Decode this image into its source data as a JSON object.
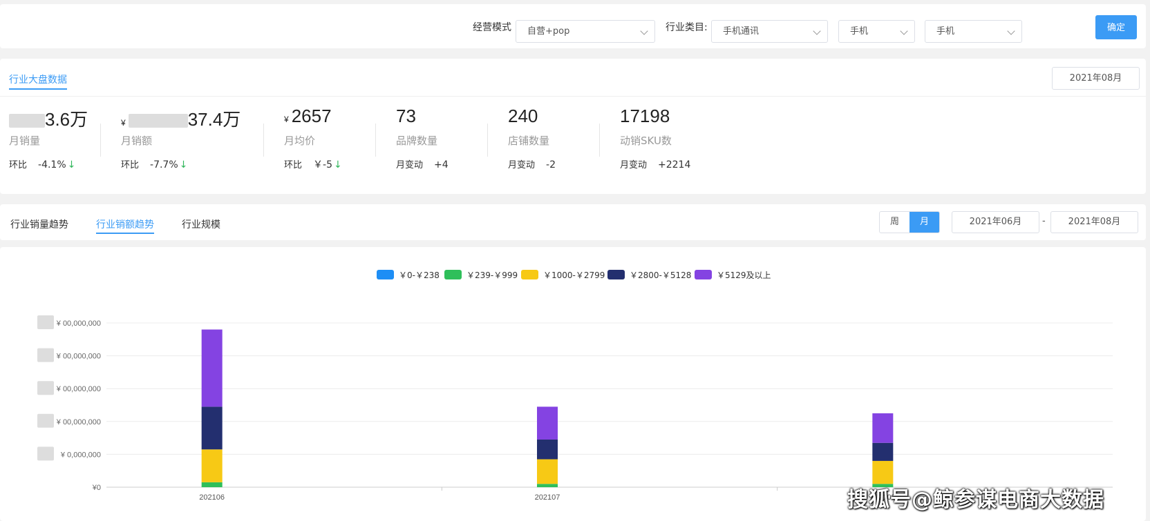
{
  "filters": {
    "mode_label": "经营模式",
    "mode_value": "自营+pop",
    "category_label": "行业类目:",
    "category_1": "手机通讯",
    "category_2": "手机",
    "category_3": "手机",
    "confirm": "确定"
  },
  "overview": {
    "title": "行业大盘数据",
    "date": "2021年08月",
    "metrics": [
      {
        "value_suffix": "3.6万",
        "label": "月销量",
        "change_key": "环比",
        "change_value": "-4.1%",
        "arrow": "↓"
      },
      {
        "currency": "¥",
        "value_suffix": "37.4万",
        "label": "月销额",
        "change_key": "环比",
        "change_value": "-7.7%",
        "arrow": "↓"
      },
      {
        "currency": "¥",
        "value": "2657",
        "label": "月均价",
        "change_key": "环比",
        "change_value": "￥-5",
        "arrow": "↓"
      },
      {
        "value": "73",
        "label": "品牌数量",
        "change_key": "月变动",
        "change_value": "+4"
      },
      {
        "value": "240",
        "label": "店铺数量",
        "change_key": "月变动",
        "change_value": "-2"
      },
      {
        "value": "17198",
        "label": "动销SKU数",
        "change_key": "月变动",
        "change_value": "+2214"
      }
    ]
  },
  "trend": {
    "tabs": [
      "行业销量趋势",
      "行业销额趋势",
      "行业规模"
    ],
    "active_tab": 1,
    "period_week": "周",
    "period_month": "月",
    "range_start": "2021年06月",
    "range_dash": "-",
    "range_end": "2021年08月"
  },
  "chart_data": {
    "type": "bar",
    "stacked": true,
    "categories": [
      "202106",
      "202107",
      "202108"
    ],
    "series": [
      {
        "name": "￥0-￥238",
        "color": "#1e8ef5",
        "values": [
          0,
          0,
          0
        ]
      },
      {
        "name": "￥239-￥999",
        "color": "#2fbf5a",
        "values": [
          0.3,
          0.2,
          0.2
        ]
      },
      {
        "name": "￥1000-￥2799",
        "color": "#f7c915",
        "values": [
          2.0,
          1.5,
          1.4
        ]
      },
      {
        "name": "￥2800-￥5128",
        "color": "#232f6f",
        "values": [
          2.6,
          1.2,
          1.1
        ]
      },
      {
        "name": "￥5129及以上",
        "color": "#8443e2",
        "values": [
          4.7,
          2.0,
          1.8
        ]
      }
    ],
    "ytick_labels": [
      "¥0",
      "¥ ",
      "¥ ",
      "¥ ",
      "¥ ",
      "¥ "
    ],
    "ytick_suffix": [
      "",
      "0,000,000",
      "00,000,000",
      "00,000,000",
      "00,000,000",
      "00,000,000"
    ],
    "ylim_units": [
      0,
      10
    ],
    "grid": true,
    "legend_position": "top-center"
  },
  "watermark": "搜狐号@鲸参谋电商大数据"
}
